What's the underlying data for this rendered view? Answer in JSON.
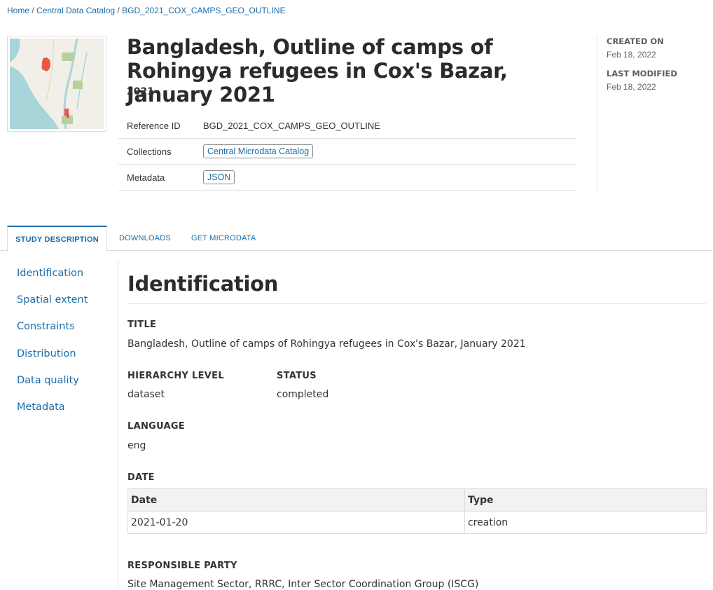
{
  "breadcrumb": {
    "items": [
      "Home",
      "Central Data Catalog",
      "BGD_2021_COX_CAMPS_GEO_OUTLINE"
    ],
    "separator": "/"
  },
  "thumbnail": {
    "alt": "map-thumbnail"
  },
  "header": {
    "title": "Bangladesh, Outline of camps of Rohingya refugees in Cox's Bazar, January 2021",
    "year": "2021",
    "rows": [
      {
        "label": "Reference ID",
        "value": "BGD_2021_COX_CAMPS_GEO_OUTLINE"
      },
      {
        "label": "Collections",
        "value": "Central Microdata Catalog"
      },
      {
        "label": "Metadata",
        "value": "JSON"
      }
    ]
  },
  "sidebar_dates": {
    "created_label": "CREATED ON",
    "created_value": "Feb 18, 2022",
    "modified_label": "LAST MODIFIED",
    "modified_value": "Feb 18, 2022"
  },
  "tabs": [
    {
      "label": "STUDY DESCRIPTION",
      "active": true
    },
    {
      "label": "DOWNLOADS",
      "active": false
    },
    {
      "label": "GET MICRODATA",
      "active": false
    }
  ],
  "leftnav": [
    "Identification",
    "Spatial extent",
    "Constraints",
    "Distribution",
    "Data quality",
    "Metadata"
  ],
  "content": {
    "section_title": "Identification",
    "title_label": "TITLE",
    "title_value": "Bangladesh, Outline of camps of Rohingya refugees in Cox's Bazar, January 2021",
    "hierarchy_label": "HIERARCHY LEVEL",
    "hierarchy_value": "dataset",
    "status_label": "STATUS",
    "status_value": "completed",
    "language_label": "LANGUAGE",
    "language_value": "eng",
    "date_label": "DATE",
    "date_table": {
      "headers": [
        "Date",
        "Type"
      ],
      "rows": [
        [
          "2021-01-20",
          "creation"
        ]
      ]
    },
    "responsible_label": "RESPONSIBLE PARTY",
    "responsible_value": "Site Management Sector, RRRC, Inter Sector Coordination Group (ISCG)"
  },
  "colors": {
    "link": "#1a6ca8",
    "map_water": "#a8d5d9",
    "map_land": "#f2efe9",
    "map_camps": "#e8564a",
    "map_parks": "#b9cf9c"
  }
}
